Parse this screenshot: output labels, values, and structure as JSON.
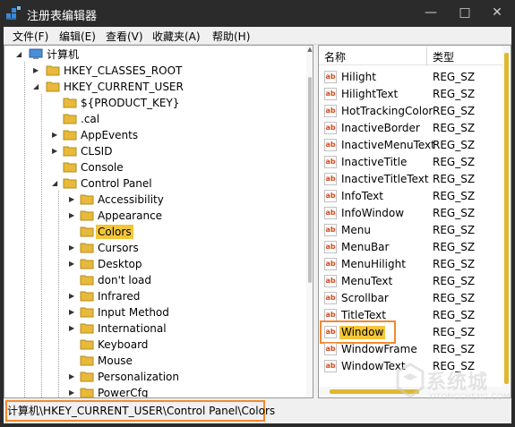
{
  "window": {
    "title": "注册表编辑器",
    "minimize_glyph": "—",
    "maximize_glyph": "□",
    "close_glyph": "✕"
  },
  "menu": {
    "items": [
      "文件(F)",
      "编辑(E)",
      "查看(V)",
      "收藏夹(A)",
      "帮助(H)"
    ]
  },
  "tree": {
    "nodes": [
      {
        "label": "计算机",
        "expanded": true
      },
      {
        "label": "HKEY_CLASSES_ROOT",
        "expanded": false
      },
      {
        "label": "HKEY_CURRENT_USER",
        "expanded": true
      },
      {
        "label": "${PRODUCT_KEY}"
      },
      {
        "label": ".cal"
      },
      {
        "label": "AppEvents",
        "expanded": false
      },
      {
        "label": "CLSID",
        "expanded": false
      },
      {
        "label": "Console"
      },
      {
        "label": "Control Panel",
        "expanded": true
      },
      {
        "label": "Accessibility",
        "expanded": false
      },
      {
        "label": "Appearance",
        "expanded": false
      },
      {
        "label": "Colors",
        "selected": true
      },
      {
        "label": "Cursors",
        "expanded": false
      },
      {
        "label": "Desktop",
        "expanded": false
      },
      {
        "label": "don't load"
      },
      {
        "label": "Infrared",
        "expanded": false
      },
      {
        "label": "Input Method",
        "expanded": false
      },
      {
        "label": "International",
        "expanded": false
      },
      {
        "label": "Keyboard"
      },
      {
        "label": "Mouse"
      },
      {
        "label": "Personalization",
        "expanded": false
      },
      {
        "label": "PowerCfg",
        "expanded": false
      }
    ]
  },
  "list": {
    "columns": {
      "name": "名称",
      "type": "类型"
    },
    "icon_text": "ab",
    "rows": [
      {
        "name": "Hilight",
        "type": "REG_SZ"
      },
      {
        "name": "HilightText",
        "type": "REG_SZ"
      },
      {
        "name": "HotTrackingColor",
        "type": "REG_SZ"
      },
      {
        "name": "InactiveBorder",
        "type": "REG_SZ"
      },
      {
        "name": "InactiveMenuText",
        "type": "REG_SZ"
      },
      {
        "name": "InactiveTitle",
        "type": "REG_SZ"
      },
      {
        "name": "InactiveTitleText",
        "type": "REG_SZ"
      },
      {
        "name": "InfoText",
        "type": "REG_SZ"
      },
      {
        "name": "InfoWindow",
        "type": "REG_SZ"
      },
      {
        "name": "Menu",
        "type": "REG_SZ"
      },
      {
        "name": "MenuBar",
        "type": "REG_SZ"
      },
      {
        "name": "MenuHilight",
        "type": "REG_SZ"
      },
      {
        "name": "MenuText",
        "type": "REG_SZ"
      },
      {
        "name": "Scrollbar",
        "type": "REG_SZ"
      },
      {
        "name": "TitleText",
        "type": "REG_SZ"
      },
      {
        "name": "Window",
        "type": "REG_SZ",
        "selected": true
      },
      {
        "name": "WindowFrame",
        "type": "REG_SZ"
      },
      {
        "name": "WindowText",
        "type": "REG_SZ"
      }
    ]
  },
  "status": {
    "path": "计算机\\HKEY_CURRENT_USER\\Control Panel\\Colors"
  },
  "watermark": {
    "cn": "系统城",
    "en": "XITONGCHENG.COM"
  },
  "colors": {
    "selection": "#f3c63a",
    "annotation_box": "#f08a30",
    "folder": "#e8b93a",
    "titlebar": "#2b2b2b"
  }
}
